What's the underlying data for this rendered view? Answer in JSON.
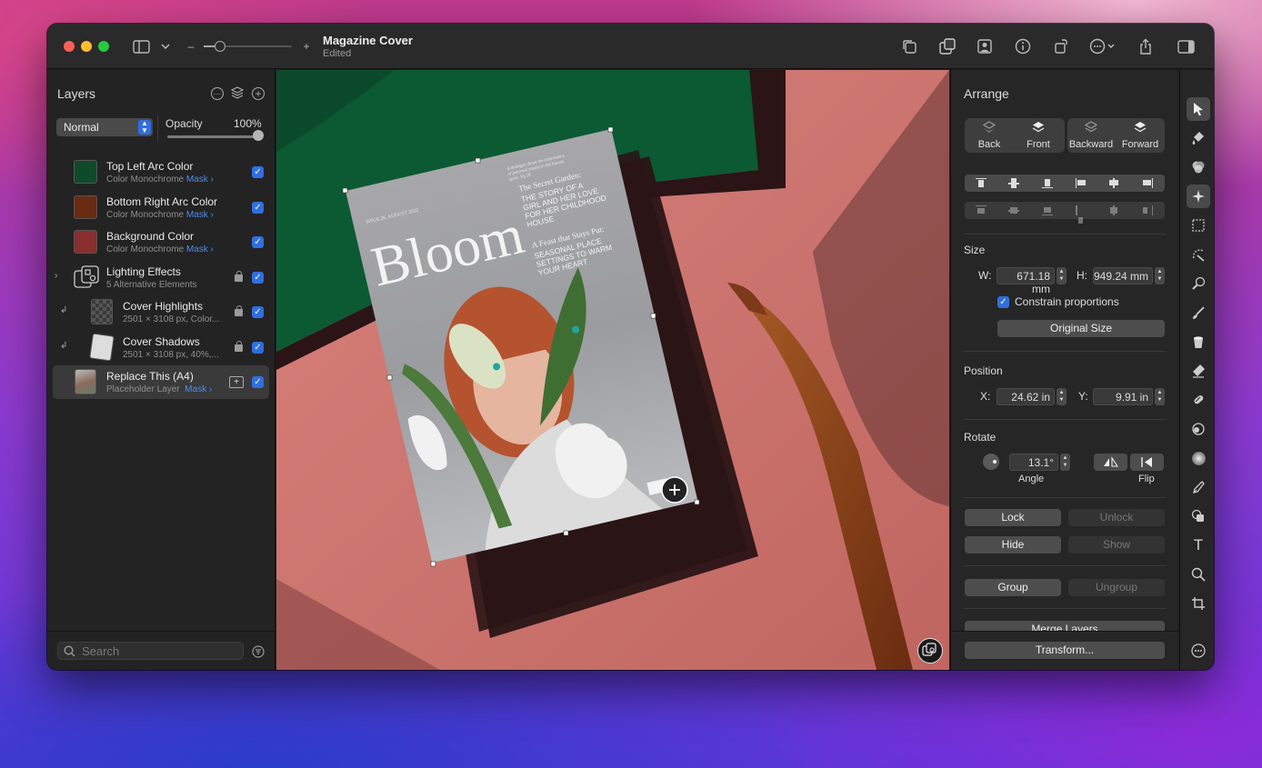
{
  "window": {
    "title": "Magazine Cover",
    "subtitle": "Edited"
  },
  "zoom": {
    "level": 0.2,
    "minus_label": "–",
    "plus_label": "+"
  },
  "layers_panel": {
    "header": "Layers",
    "blend_mode": "Normal",
    "opacity_label": "Opacity",
    "opacity_value": "100%",
    "layers": [
      {
        "name": "Top Left Arc Color",
        "detail": "Color Monochrome",
        "mask": "Mask ›",
        "color": "#0f4b2a",
        "visible": true
      },
      {
        "name": "Bottom Right Arc Color",
        "detail": "Color Monochrome",
        "mask": "Mask ›",
        "color": "#6b2a12",
        "visible": true
      },
      {
        "name": "Background Color",
        "detail": "Color Monochrome",
        "mask": "Mask ›",
        "color": "#8a2e2e",
        "visible": true
      },
      {
        "name": "Lighting Effects",
        "detail": "5 Alternative Elements",
        "visible": true,
        "locked": true
      },
      {
        "name": "Cover Highlights",
        "detail": "2501 × 3108 px, Color...",
        "visible": true,
        "locked": true
      },
      {
        "name": "Cover Shadows",
        "detail": "2501 × 3108 px, 40%,...",
        "visible": true,
        "locked": true
      },
      {
        "name": "Replace This (A4)",
        "detail": "Placeholder Layer",
        "mask": "Mask ›",
        "visible": true,
        "selected": true
      }
    ],
    "search_placeholder": "Search"
  },
  "canvas": {
    "cover": {
      "issue": "ISSUE 26, AUGUST 2022",
      "title": "Bloom",
      "teaser_top": "A dialogue about the importance of personal rituals to the human spirit. Pg 28",
      "story1_title": "The Secret Garden:",
      "story1_body": "THE STORY OF A GIRL AND HER LOVE FOR HER CHILDHOOD HOUSE",
      "story2_title": "A Feast that Stays Put:",
      "story2_body": "SEASONAL PLACE SETTINGS TO WARM YOUR HEART"
    }
  },
  "arrange_panel": {
    "header": "Arrange",
    "order_buttons": [
      "Back",
      "Front",
      "Backward",
      "Forward"
    ],
    "size_label": "Size",
    "width_label": "W:",
    "width_value": "671.18 mm",
    "height_label": "H:",
    "height_value": "949.24 mm",
    "constrain_label": "Constrain proportions",
    "original_size": "Original Size",
    "position_label": "Position",
    "x_label": "X:",
    "x_value": "24.62 in",
    "y_label": "Y:",
    "y_value": "9.91 in",
    "rotate_label": "Rotate",
    "angle_value": "13.1°",
    "angle_label": "Angle",
    "flip_label": "Flip",
    "lock": "Lock",
    "unlock": "Unlock",
    "hide": "Hide",
    "show": "Show",
    "group": "Group",
    "ungroup": "Ungroup",
    "merge_layers": "Merge Layers",
    "transform": "Transform..."
  },
  "colors": {
    "accent": "#2f6fe0",
    "mask_link": "#4b8cf0",
    "panel_bg": "#232323"
  }
}
